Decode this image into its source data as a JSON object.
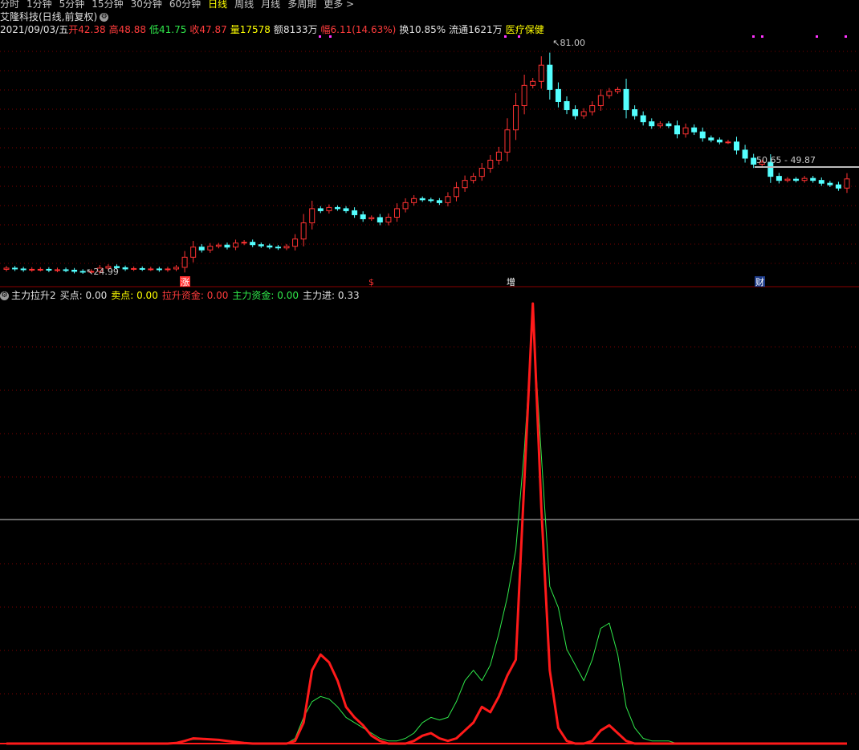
{
  "tabs": [
    "分时",
    "1分钟",
    "5分钟",
    "15分钟",
    "30分钟",
    "60分钟",
    "日线",
    "周线",
    "月线",
    "多周期",
    "更多 >"
  ],
  "active_tab": "日线",
  "stock": {
    "title": "艾隆科技(日线,前复权)",
    "settings_icon": "gear-icon"
  },
  "ohlc": {
    "date": "2021/09/03/五",
    "open_label": "开",
    "open": "42.38",
    "high_label": "高",
    "high": "48.88",
    "low_label": "低",
    "low": "41.75",
    "close_label": "收",
    "close": "47.87",
    "vol_label": "量",
    "vol": "17578",
    "amount_label": "额",
    "amount": "8133万",
    "change_label": "幅",
    "change": "6.11(14.63%)",
    "turnover_label": "换",
    "turnover": "10.85%",
    "float_label": "流通",
    "float": "1621万",
    "sector": "医疗保健"
  },
  "price_chart": {
    "high_label": "81.00",
    "low_label": "24.99",
    "range_label": "50.65 - 49.87",
    "event_tags": [
      "涨",
      "$",
      "增",
      "财"
    ],
    "colors": {
      "up": "#ff3232",
      "down": "#54ffff",
      "grid": "#7a0000"
    }
  },
  "indicator": {
    "name": "主力拉升2",
    "buy_label": "买点:",
    "buy": "0.00",
    "sell_label": "卖点:",
    "sell": "0.00",
    "pull_label": "拉升资金:",
    "pull": "0.00",
    "main_label": "主力资金:",
    "main": "0.00",
    "in_label": "主力进:",
    "in": "0.33",
    "colors": {
      "pull": "#ff1a1a",
      "main": "#2fe84a"
    }
  },
  "chart_data": {
    "type": "line",
    "candles_close": [
      25.8,
      25.6,
      25.4,
      25.5,
      25.5,
      25.3,
      25.4,
      25.3,
      25.0,
      24.9,
      24.99,
      25.8,
      26.2,
      25.9,
      25.6,
      25.7,
      25.6,
      25.6,
      25.4,
      25.6,
      26.0,
      28.5,
      31.0,
      30.3,
      31.2,
      31.5,
      31.0,
      32.0,
      32.2,
      31.6,
      31.3,
      31.0,
      30.8,
      31.2,
      33.0,
      37.0,
      40.5,
      40.0,
      40.8,
      40.5,
      40.0,
      39.0,
      38.0,
      38.3,
      37.2,
      38.4,
      40.5,
      42.0,
      43.0,
      42.7,
      42.5,
      42.0,
      43.5,
      45.7,
      47.5,
      48.5,
      50.5,
      52.5,
      54.5,
      60.0,
      66.0,
      71.0,
      72.0,
      76.0,
      70.0,
      67.0,
      65.0,
      63.5,
      64.5,
      66.0,
      68.5,
      69.5,
      70.0,
      65.0,
      63.5,
      62.0,
      61.0,
      61.5,
      61.0,
      59.0,
      60.5,
      59.5,
      58.0,
      57.5,
      57.0,
      57.0,
      55.0,
      53.0,
      51.5,
      52.0,
      48.5,
      47.5,
      47.8,
      47.5,
      48.0,
      47.5,
      46.8,
      46.4,
      45.6,
      47.87
    ],
    "series": [
      {
        "name": "拉升资金",
        "values": [
          0,
          0,
          0,
          0,
          0,
          0,
          0,
          0,
          0,
          0,
          0,
          0,
          0,
          0,
          0,
          0,
          0,
          0,
          0,
          0,
          0.01,
          0.05,
          0.1,
          0.09,
          0.08,
          0.07,
          0.05,
          0.03,
          0.01,
          0,
          0,
          0,
          0,
          0,
          0.05,
          0.4,
          1.4,
          1.7,
          1.55,
          1.2,
          0.7,
          0.5,
          0.35,
          0.15,
          0.05,
          0,
          0,
          0,
          0.05,
          0.15,
          0.2,
          0.1,
          0.05,
          0.1,
          0.25,
          0.4,
          0.7,
          0.6,
          0.9,
          1.3,
          1.6,
          5.0,
          8.4,
          4.5,
          1.4,
          0.3,
          0.05,
          0,
          0,
          0.05,
          0.25,
          0.35,
          0.2,
          0.05,
          0,
          0,
          0,
          0,
          0,
          0,
          0,
          0,
          0,
          0,
          0,
          0,
          0,
          0,
          0,
          0,
          0,
          0,
          0,
          0,
          0,
          0,
          0,
          0,
          0,
          0
        ]
      },
      {
        "name": "主力资金",
        "values": [
          0,
          0,
          0,
          0,
          0,
          0,
          0,
          0,
          0,
          0,
          0,
          0,
          0,
          0,
          0,
          0,
          0,
          0,
          0,
          0,
          0.01,
          0.05,
          0.08,
          0.08,
          0.07,
          0.06,
          0.05,
          0.03,
          0.01,
          0,
          0,
          0,
          0,
          0,
          0.1,
          0.5,
          0.8,
          0.9,
          0.85,
          0.7,
          0.5,
          0.4,
          0.3,
          0.2,
          0.1,
          0.05,
          0.05,
          0.1,
          0.2,
          0.4,
          0.5,
          0.45,
          0.5,
          0.8,
          1.2,
          1.4,
          1.2,
          1.5,
          2.1,
          2.8,
          3.7,
          5.6,
          8.1,
          5.5,
          3.0,
          2.6,
          1.8,
          1.5,
          1.2,
          1.6,
          2.2,
          2.3,
          1.7,
          0.7,
          0.3,
          0.1,
          0.05,
          0.05,
          0.05,
          0,
          0,
          0,
          0,
          0,
          0,
          0,
          0,
          0,
          0,
          0,
          0,
          0,
          0,
          0,
          0,
          0,
          0,
          0,
          0,
          0
        ]
      }
    ]
  }
}
